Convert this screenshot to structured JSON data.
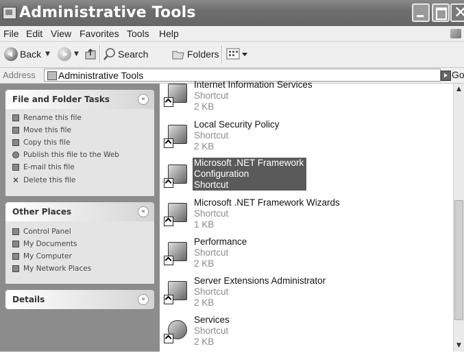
{
  "window": {
    "title": "Administrative Tools"
  },
  "menu": [
    "File",
    "Edit",
    "View",
    "Favorites",
    "Tools",
    "Help"
  ],
  "toolbar": {
    "back_label": "Back",
    "search_label": "Search",
    "folders_label": "Folders"
  },
  "address": {
    "label": "Address",
    "value": "Administrative Tools",
    "go_label": "Go"
  },
  "taskpane": {
    "file_tasks": {
      "title": "File and Folder Tasks",
      "items": [
        "Rename this file",
        "Move this file",
        "Copy this file",
        "Publish this file to the Web",
        "E-mail this file",
        "Delete this file"
      ]
    },
    "other_places": {
      "title": "Other Places",
      "items": [
        "Control Panel",
        "My Documents",
        "My Computer",
        "My Network Places"
      ]
    },
    "details": {
      "title": "Details"
    }
  },
  "files": [
    {
      "name": "Internet Information Services",
      "type": "Shortcut",
      "size": "2 KB"
    },
    {
      "name": "Local Security Policy",
      "type": "Shortcut",
      "size": "2 KB"
    },
    {
      "name": "Microsoft .NET Framework",
      "name2": "Configuration",
      "type": "Shortcut",
      "selected": true
    },
    {
      "name": "Microsoft .NET Framework Wizards",
      "type": "Shortcut",
      "size": "1 KB"
    },
    {
      "name": "Performance",
      "type": "Shortcut",
      "size": "2 KB"
    },
    {
      "name": "Server Extensions Administrator",
      "type": "Shortcut",
      "size": "2 KB"
    },
    {
      "name": "Services",
      "type": "Shortcut",
      "size": "2 KB"
    }
  ]
}
